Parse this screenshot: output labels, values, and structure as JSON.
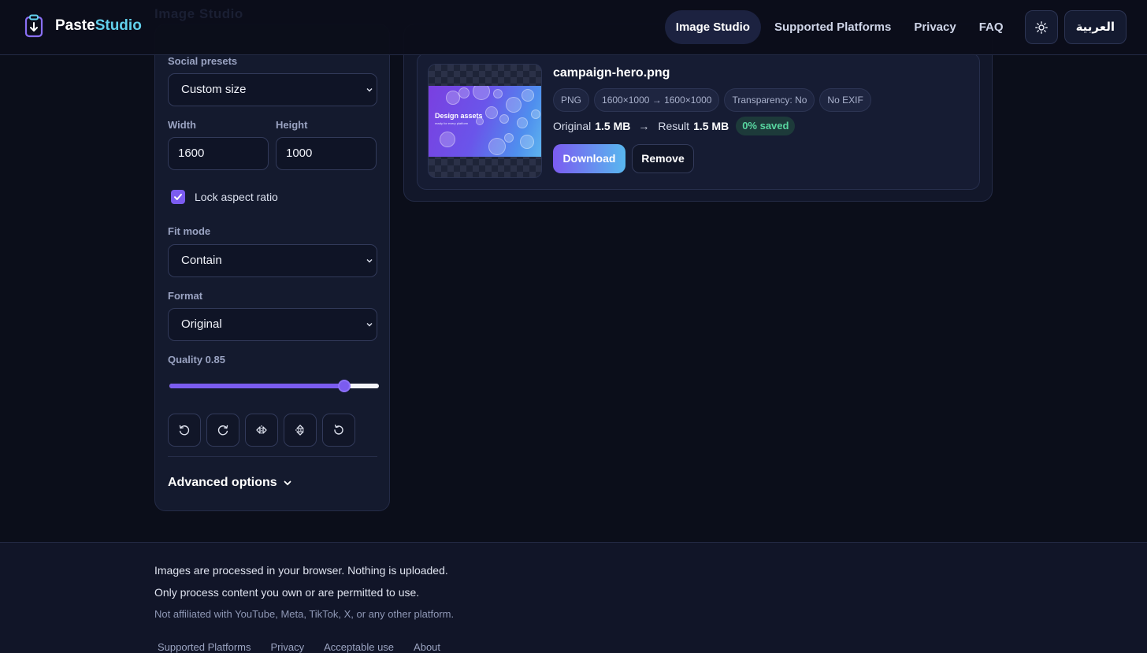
{
  "header": {
    "brand_part1": "Paste",
    "brand_part2": "Studio",
    "ghost_title": "Image Studio",
    "nav": [
      "Image Studio",
      "Supported Platforms",
      "Privacy",
      "FAQ"
    ],
    "active_nav": "Image Studio",
    "theme_icon": "sun-icon",
    "lang_label": "العربية"
  },
  "settings": {
    "social_presets_label": "Social presets",
    "social_presets_value": "Custom size",
    "width_label": "Width",
    "width_value": "1600",
    "height_label": "Height",
    "height_value": "1000",
    "lock_aspect_label": "Lock aspect ratio",
    "lock_aspect_checked": true,
    "fit_mode_label": "Fit mode",
    "fit_mode_value": "Contain",
    "format_label": "Format",
    "format_value": "Original",
    "quality_label": "Quality 0.85",
    "quality_value": 0.85,
    "tools": [
      "rotate-left-icon",
      "rotate-right-icon",
      "flip-horizontal-icon",
      "flip-vertical-icon",
      "reset-icon"
    ],
    "advanced_label": "Advanced options"
  },
  "file": {
    "name": "campaign-hero.png",
    "thumb_title": "Design assets",
    "thumb_subtitle": "ready for every platform",
    "chips": [
      "PNG",
      "1600×1000 → 1600×1000",
      "Transparency: No",
      "No EXIF"
    ],
    "original_label": "Original",
    "original_size": "1.5 MB",
    "arrow": "→",
    "result_label": "Result",
    "result_size": "1.5 MB",
    "saved": "0% saved",
    "download_label": "Download",
    "remove_label": "Remove"
  },
  "footer": {
    "line1": "Images are processed in your browser. Nothing is uploaded.",
    "line2": "Only process content you own or are permitted to use.",
    "line3": "Not affiliated with YouTube, Meta, TikTok, X, or any other platform.",
    "links": [
      "Supported Platforms",
      "Privacy",
      "Acceptable use",
      "About"
    ]
  },
  "colors": {
    "accent": "#7b5cf0",
    "accent2": "#62d0ec",
    "saved_text": "#58d6a0",
    "background": "#0b0e1a"
  }
}
